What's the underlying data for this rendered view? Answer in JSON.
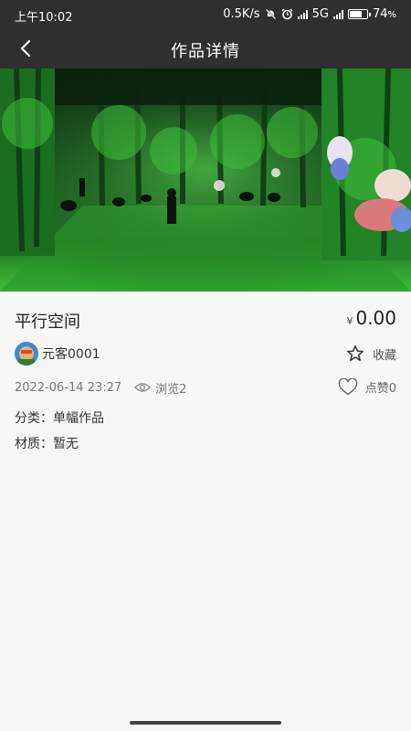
{
  "status_bar": {
    "time": "上午10:02",
    "net_speed": "0.5K/s",
    "network": "5G",
    "battery_text": "74",
    "battery_unit": "%",
    "battery_level": 0.74,
    "icons": [
      "mute-bell-icon",
      "alarm-icon",
      "signal-icon",
      "battery-icon"
    ]
  },
  "header": {
    "title": "作品详情",
    "back_icon": "chevron-left-icon"
  },
  "artwork": {
    "title": "平行空间",
    "currency": "¥",
    "price": "0.00",
    "author": "元客0001",
    "favorite_label": "收藏",
    "date": "2022-06-14 23:27",
    "views_label": "浏览2",
    "likes_label": "点赞0",
    "category_label": "分类：",
    "category_value": "单幅作品",
    "material_label": "材质：",
    "material_value": "暂无"
  },
  "colors": {
    "header_bg": "#2f2f2f",
    "page_bg": "#f7f7f7"
  }
}
